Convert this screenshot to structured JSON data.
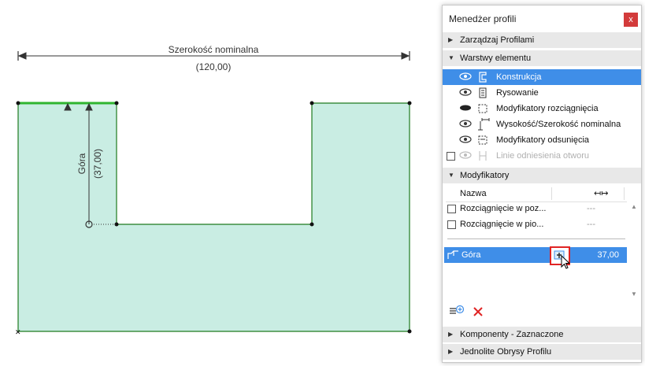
{
  "canvas": {
    "dimension": {
      "label": "Szerokość nominalna",
      "value": "(120,00)"
    },
    "vertical_dimension": {
      "label": "Góra",
      "value": "(37,00)"
    }
  },
  "panel": {
    "title": "Menedżer profili",
    "close_glyph": "x",
    "sections": {
      "manage": "Zarządzaj Profilami",
      "layers": "Warstwy elementu",
      "modifiers": "Modyfikatory",
      "components": "Komponenty - Zaznaczone",
      "outlines": "Jednolite Obrysy Profilu"
    },
    "layers": [
      {
        "label": "Konstrukcja",
        "icon": "structure-icon",
        "selected": true
      },
      {
        "label": "Rysowanie",
        "icon": "drawing-icon"
      },
      {
        "label": "Modyfikatory rozciągnięcia",
        "icon": "stretch-modifier-icon"
      },
      {
        "label": "Wysokość/Szerokość nominalna",
        "icon": "nominal-size-icon"
      },
      {
        "label": "Modyfikatory odsunięcia",
        "icon": "offset-modifier-icon"
      },
      {
        "label": "Linie odniesienia otworu",
        "icon": "opening-reference-icon",
        "disabled": true
      }
    ],
    "modifiers_table": {
      "col_name": "Nazwa",
      "col_icon": "stretch-arrows-icon",
      "rows": [
        {
          "label": "Rozciągnięcie w poz...",
          "value": "---"
        },
        {
          "label": "Rozciągnięcie w pio...",
          "value": "---"
        }
      ],
      "offset_row": {
        "label": "Góra",
        "value": "37,00"
      }
    },
    "accent": "#3f8ee8",
    "fill": "#c9ede3",
    "edge": "#1f7a1f"
  }
}
